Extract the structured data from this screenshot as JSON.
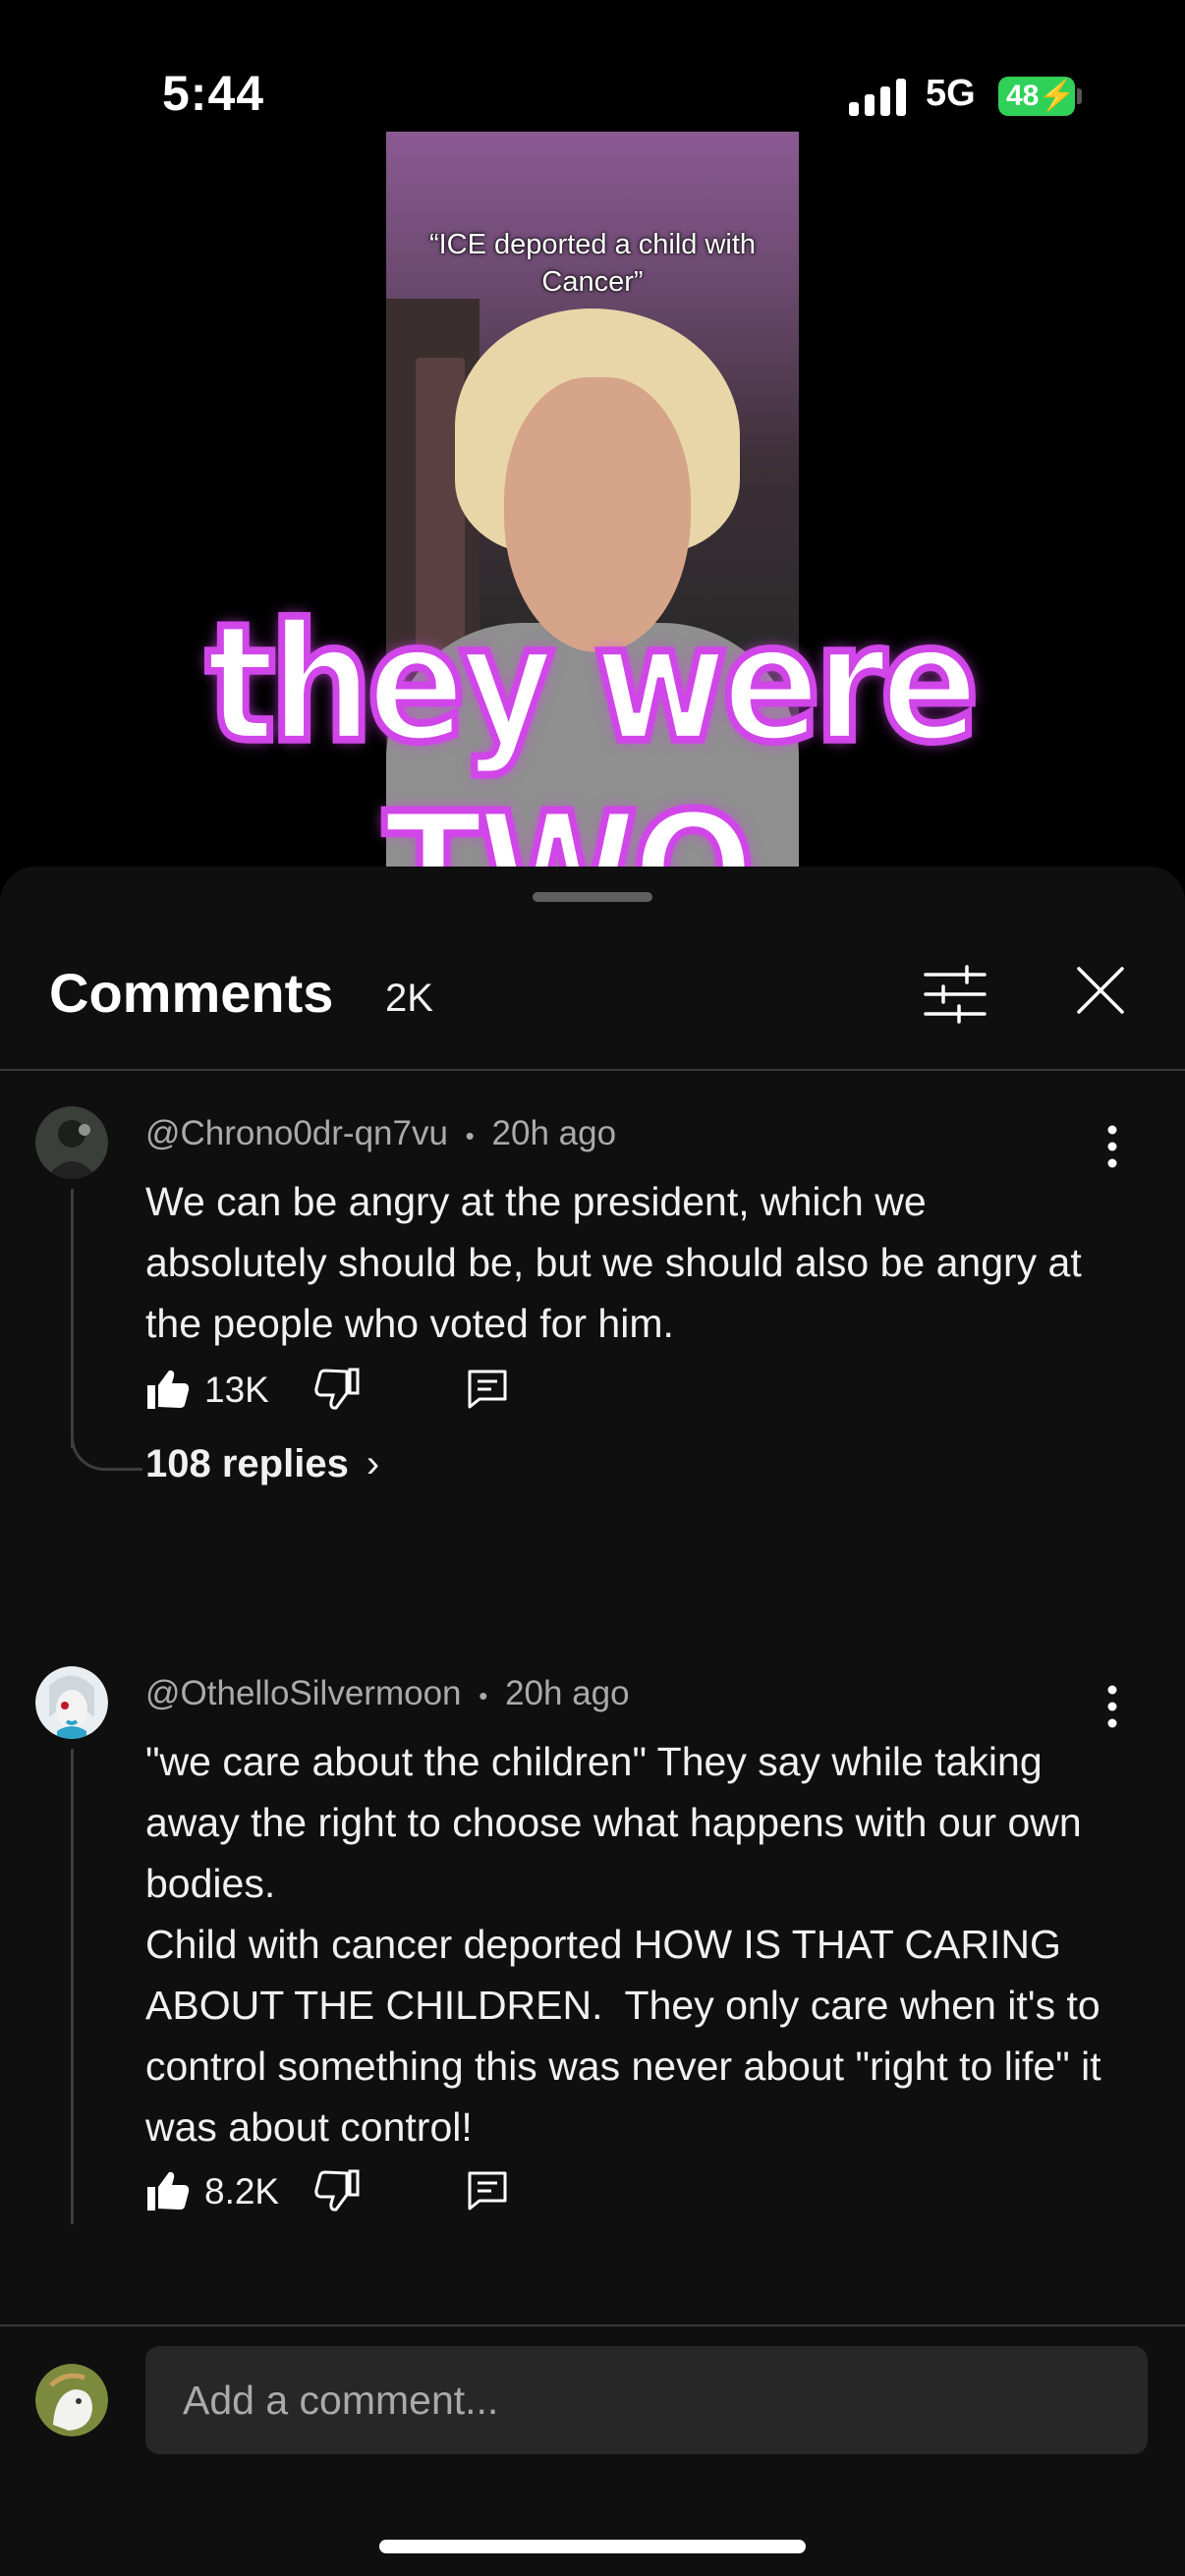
{
  "status_bar": {
    "time": "5:44",
    "network": "5G",
    "battery": "48",
    "icons": [
      "signal-icon",
      "battery-charging-icon"
    ]
  },
  "video": {
    "caption": "“ICE deported a child with Cancer”",
    "overlay_text": "they were TWO.",
    "overlay_colors": {
      "fill": "#ffffff",
      "outline": "#d046e8"
    }
  },
  "comments_panel": {
    "title": "Comments",
    "count": "2K",
    "icons": [
      "sort-filter-icon",
      "close-icon"
    ],
    "items": [
      {
        "author": "@Chrono0dr-qn7vu",
        "time": "20h ago",
        "text": "We can be angry at the president, which we absolutely should be, but we should also be angry at the people who voted for him.",
        "likes": "13K",
        "replies_label": "108 replies",
        "chevron": "›"
      },
      {
        "author": "@OthelloSilvermoon",
        "time": "20h ago",
        "text": "\"we care about the children\" They say while taking away the right to choose what happens with our own bodies.\nChild with cancer deported HOW IS THAT CARING ABOUT THE CHILDREN.  They only care when it's to control something this was never about \"right to life\" it was about control!",
        "likes": "8.2K"
      }
    ],
    "separator": "•"
  },
  "composer": {
    "placeholder": "Add a comment..."
  }
}
